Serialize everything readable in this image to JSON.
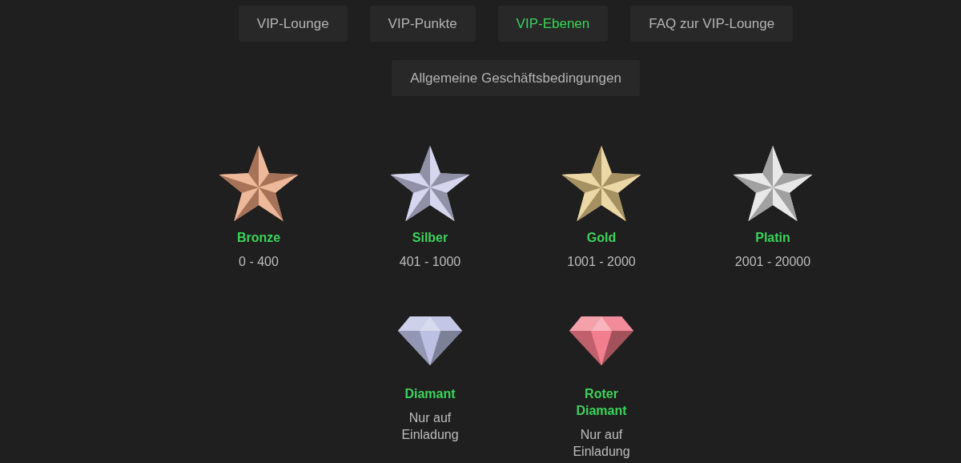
{
  "tabs": [
    {
      "label": "VIP-Lounge",
      "selected": false
    },
    {
      "label": "VIP-Punkte",
      "selected": false
    },
    {
      "label": "VIP-Ebenen",
      "selected": true
    },
    {
      "label": "FAQ zur VIP-Lounge",
      "selected": false
    }
  ],
  "terms_button": "Allgemeine Geschäftsbedingungen",
  "levels": [
    {
      "kind": "star",
      "name": "Bronze",
      "range": "0 - 400",
      "color": "#e8a07a"
    },
    {
      "kind": "star",
      "name": "Silber",
      "range": "401 - 1000",
      "color": "#c8c8e8"
    },
    {
      "kind": "star",
      "name": "Gold",
      "range": "1001 - 2000",
      "color": "#e6c98a"
    },
    {
      "kind": "star",
      "name": "Platin",
      "range": "2001 - 20000",
      "color": "#e0e0e0"
    },
    {
      "kind": "diamond",
      "name": "Diamant",
      "range": "Nur auf Einladung",
      "color": "#b8bde0"
    },
    {
      "kind": "diamond",
      "name": "Roter Diamant",
      "range": "Nur auf Einladung",
      "color": "#f07888"
    }
  ]
}
